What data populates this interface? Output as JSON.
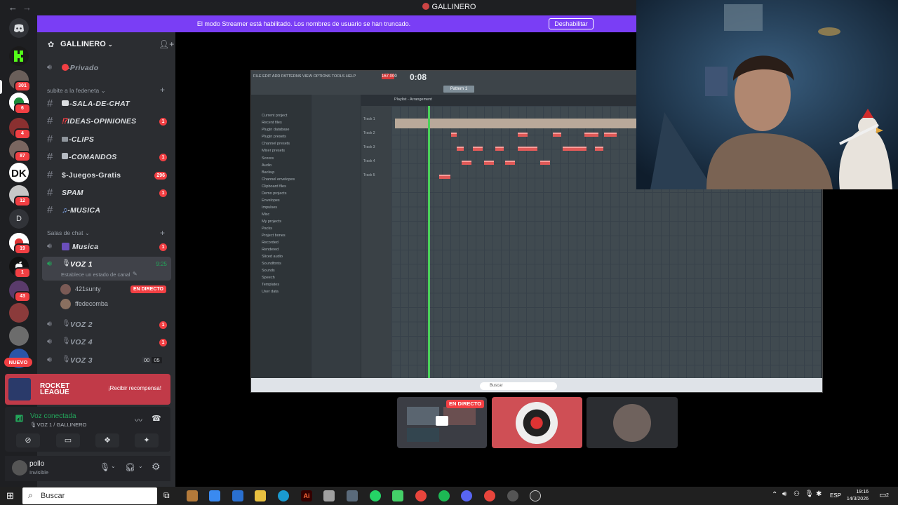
{
  "window": {
    "title": "GALLINERO",
    "back_arrow": "←",
    "forward_arrow": "→"
  },
  "banner": {
    "text": "El modo Streamer está habilitado. Los nombres de usuario se han truncado.",
    "button": "Deshabilitar"
  },
  "rail": {
    "badges": [
      "301",
      "6",
      "4",
      "87",
      "12",
      "19",
      "1",
      "43"
    ],
    "letter_server": "D",
    "new_label": "NUEVO"
  },
  "server": {
    "name": "GALLINERO"
  },
  "channels": {
    "privado": "-Privado",
    "category1": "subite a la fedeneta",
    "text": [
      {
        "label": "-SALA-DE-CHAT",
        "badge": ""
      },
      {
        "label": "IDEAS-OPINIONES",
        "badge": "1"
      },
      {
        "label": "-CLIPS",
        "badge": ""
      },
      {
        "label": "-COMANDOS",
        "badge": "1"
      },
      {
        "label": "$-Juegos-Gratis",
        "badge": "296"
      },
      {
        "label": "SPAM",
        "badge": "1"
      },
      {
        "label": "-MUSICA",
        "badge": ""
      }
    ],
    "category2": "Salas de chat",
    "voice": [
      {
        "label": "Musica",
        "badge": "1"
      }
    ],
    "active_voice": {
      "label": "VOZ 1",
      "time": "9:25",
      "status": "Establece un estado de canal"
    },
    "members": [
      {
        "name": "421sunty",
        "tag": "EN DIRECTO"
      },
      {
        "name": "ffedecomba",
        "tag": ""
      }
    ],
    "other_voice": [
      {
        "label": "VOZ 2",
        "badge": "1"
      },
      {
        "label": "VOZ 4",
        "badge": "1"
      },
      {
        "label": "VOZ 3",
        "count_a": "00",
        "count_b": "05"
      }
    ]
  },
  "promo": {
    "brand_line1": "ROCKET",
    "brand_line2": "LEAGUE",
    "cta": "¡Recibir recompensa!"
  },
  "voice_panel": {
    "status": "Voz conectada",
    "channel": "VOZ 1 / GALLINERO"
  },
  "user": {
    "name": "pollo",
    "status": "Invisible"
  },
  "stream": {
    "fl_menu": "FILE EDIT ADD PATTERNS VIEW OPTIONS TOOLS HELP",
    "fl_time": "0:08",
    "fl_tempo": "167.000",
    "fl_pattern": "Pattern 1",
    "fl_playlist": "Playlist - Arrangement",
    "browser_items": [
      "Current project",
      "Recent files",
      "Plugin database",
      "Plugin presets",
      "Channel presets",
      "Mixer presets",
      "Scores",
      "Audio",
      "Backup",
      "Channel envelopes",
      "Clipboard files",
      "Demo projects",
      "Envelopes",
      "Impulses",
      "Misc",
      "My projects",
      "Packs",
      "Project bones",
      "Recorded",
      "Rendered",
      "Sliced audio",
      "Soundfonts",
      "Sounds",
      "Speech",
      "Templates",
      "User data"
    ],
    "tracks": [
      "Track 1",
      "Track 2",
      "Track 3",
      "Track 4",
      "Track 5"
    ],
    "fl_taskbar_search": "Buscar",
    "live_badge": "EN DIRECTO"
  },
  "taskbar": {
    "search": "Buscar",
    "lang": "ESP",
    "time": "19:16",
    "date": "14/3/2026",
    "notif": "2"
  }
}
